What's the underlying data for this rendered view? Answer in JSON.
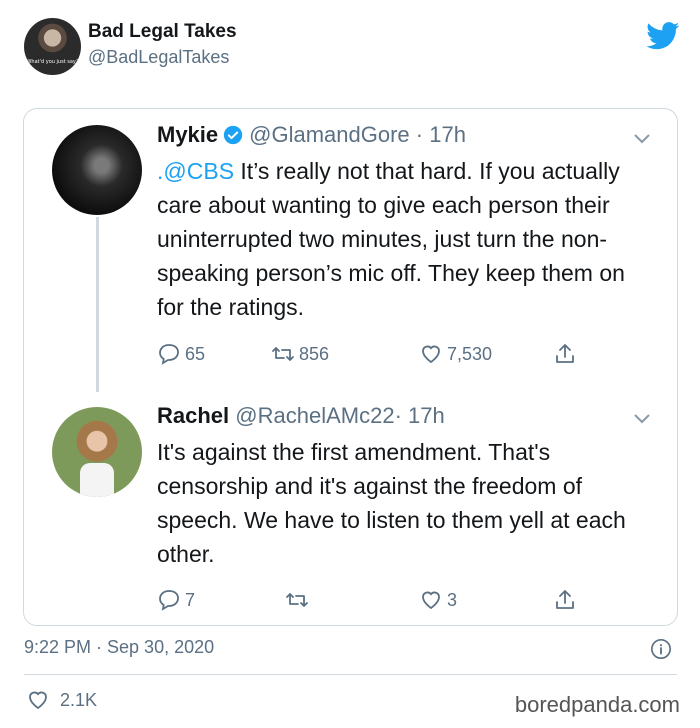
{
  "account": {
    "name": "Bad Legal Takes",
    "handle": "@BadLegalTakes",
    "avatar_caption": "What'd you just say?"
  },
  "tweet1": {
    "name": "Mykie",
    "handle": "@GlamandGore",
    "time": "· 17h",
    "mention": ".@CBS",
    "body": "It’s really not that hard. If you actually care about wanting to give each person their uninterrupted two minutes, just turn the non-speaking person’s mic off. They keep them on for the ratings.",
    "replies": "65",
    "retweets": "856",
    "likes": "7,530"
  },
  "tweet2": {
    "name": "Rachel",
    "handle": "@RachelAMc22",
    "time": "· 17h",
    "body": "It's against the first amendment. That's censorship and it's against the freedom of speech. We have to listen to them yell at each other.",
    "replies": "7",
    "retweets": "",
    "likes": "3"
  },
  "footer": {
    "timestamp": "9:22 PM · Sep 30, 2020",
    "likes": "2.1K",
    "watermark": "boredpanda.com"
  },
  "colors": {
    "accent": "#1da1f2",
    "muted": "#5b7083",
    "border": "#cfd9de"
  }
}
